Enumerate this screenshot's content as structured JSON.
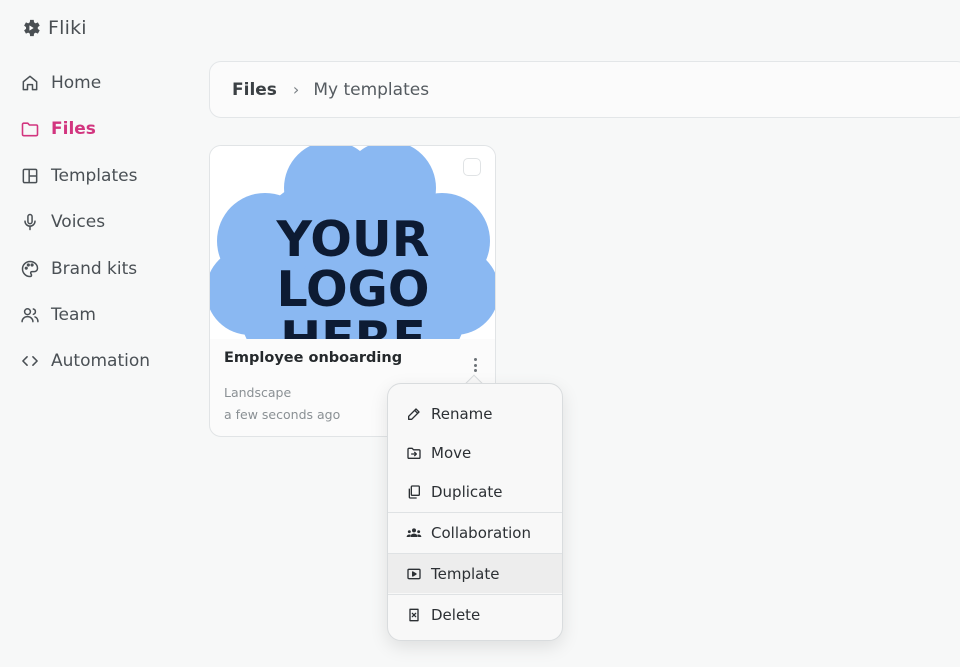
{
  "brand": {
    "name": "Fliki",
    "icon": "gear-icon"
  },
  "sidebar": {
    "items": [
      {
        "label": "Home",
        "icon": "home-icon",
        "active": false
      },
      {
        "label": "Files",
        "icon": "folder-icon",
        "active": true
      },
      {
        "label": "Templates",
        "icon": "layout-icon",
        "active": false
      },
      {
        "label": "Voices",
        "icon": "microphone-icon",
        "active": false
      },
      {
        "label": "Brand kits",
        "icon": "palette-icon",
        "active": false
      },
      {
        "label": "Team",
        "icon": "users-icon",
        "active": false
      },
      {
        "label": "Automation",
        "icon": "code-icon",
        "active": false
      }
    ]
  },
  "breadcrumb": {
    "root": "Files",
    "separator": "›",
    "current": "My templates"
  },
  "card": {
    "thumbnail_lines": [
      "YOUR",
      "LOGO",
      "HERE"
    ],
    "title": "Employee onboarding",
    "orientation": "Landscape",
    "updated": "a few seconds ago"
  },
  "menu": {
    "items": [
      {
        "label": "Rename",
        "icon": "pencil-icon"
      },
      {
        "label": "Move",
        "icon": "folder-move-icon"
      },
      {
        "label": "Duplicate",
        "icon": "copy-icon"
      },
      {
        "label": "Collaboration",
        "icon": "people-icon"
      },
      {
        "label": "Template",
        "icon": "play-box-icon"
      },
      {
        "label": "Delete",
        "icon": "trash-icon"
      }
    ]
  },
  "colors": {
    "accent": "#d2357f",
    "thumbnail_blob": "#8ab8f2",
    "thumbnail_text": "#0d1b33"
  }
}
